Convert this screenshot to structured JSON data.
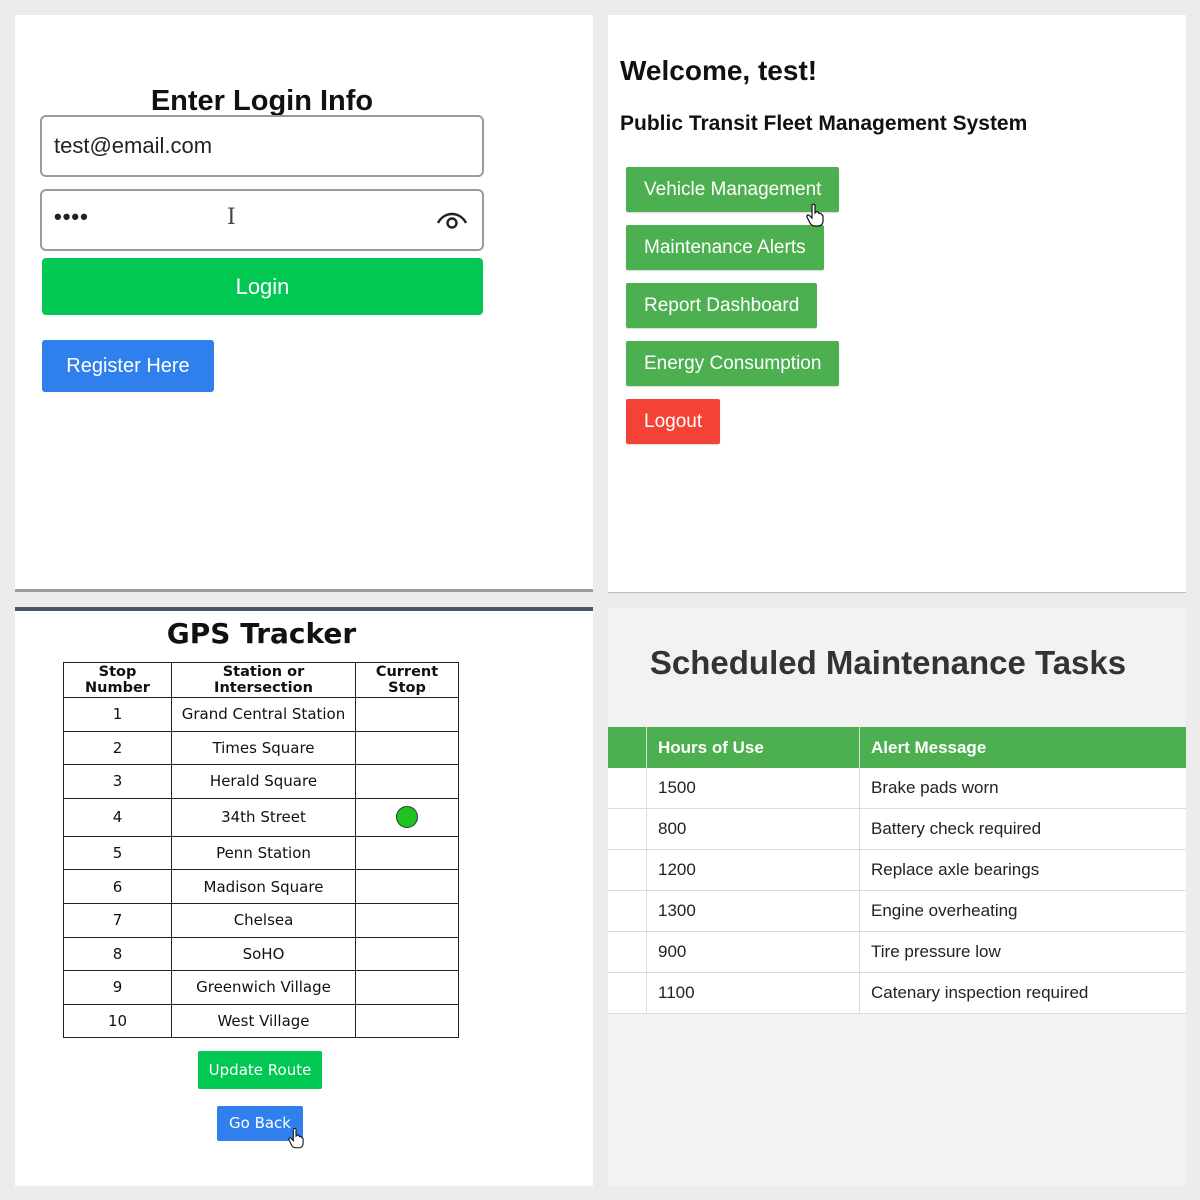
{
  "login": {
    "title": "Enter Login Info",
    "email_value": "test@email.com",
    "password_value": "••••",
    "login_label": "Login",
    "register_label": "Register Here"
  },
  "dashboard": {
    "welcome": "Welcome, test!",
    "subtitle": "Public Transit Fleet Management System",
    "buttons": [
      {
        "label": "Vehicle Management"
      },
      {
        "label": "Maintenance Alerts"
      },
      {
        "label": "Report Dashboard"
      },
      {
        "label": "Energy Consumption"
      }
    ],
    "logout_label": "Logout"
  },
  "gps": {
    "title": "GPS Tracker",
    "headers": [
      "Stop Number",
      "Station or Intersection",
      "Current Stop"
    ],
    "rows": [
      {
        "num": "1",
        "station": "Grand Central Station",
        "current": false
      },
      {
        "num": "2",
        "station": "Times Square",
        "current": false
      },
      {
        "num": "3",
        "station": "Herald Square",
        "current": false
      },
      {
        "num": "4",
        "station": "34th Street",
        "current": true
      },
      {
        "num": "5",
        "station": "Penn Station",
        "current": false
      },
      {
        "num": "6",
        "station": "Madison Square",
        "current": false
      },
      {
        "num": "7",
        "station": "Chelsea",
        "current": false
      },
      {
        "num": "8",
        "station": "SoHO",
        "current": false
      },
      {
        "num": "9",
        "station": "Greenwich Village",
        "current": false
      },
      {
        "num": "10",
        "station": "West Village",
        "current": false
      }
    ],
    "update_label": "Update Route",
    "back_label": "Go Back"
  },
  "maintenance": {
    "title": "Scheduled Maintenance Tasks",
    "headers": [
      "",
      "Hours of Use",
      "Alert Message"
    ],
    "rows": [
      {
        "hours": "1500",
        "message": "Brake pads worn"
      },
      {
        "hours": "800",
        "message": "Battery check required"
      },
      {
        "hours": "1200",
        "message": "Replace axle bearings"
      },
      {
        "hours": "1300",
        "message": "Engine overheating"
      },
      {
        "hours": "900",
        "message": "Tire pressure low"
      },
      {
        "hours": "1100",
        "message": "Catenary inspection required"
      }
    ]
  },
  "colors": {
    "green_primary": "#00c853",
    "green_menu": "#4caf50",
    "blue_button": "#2f80ed",
    "red_logout": "#f44336",
    "current_stop_dot": "#1ec31e"
  }
}
